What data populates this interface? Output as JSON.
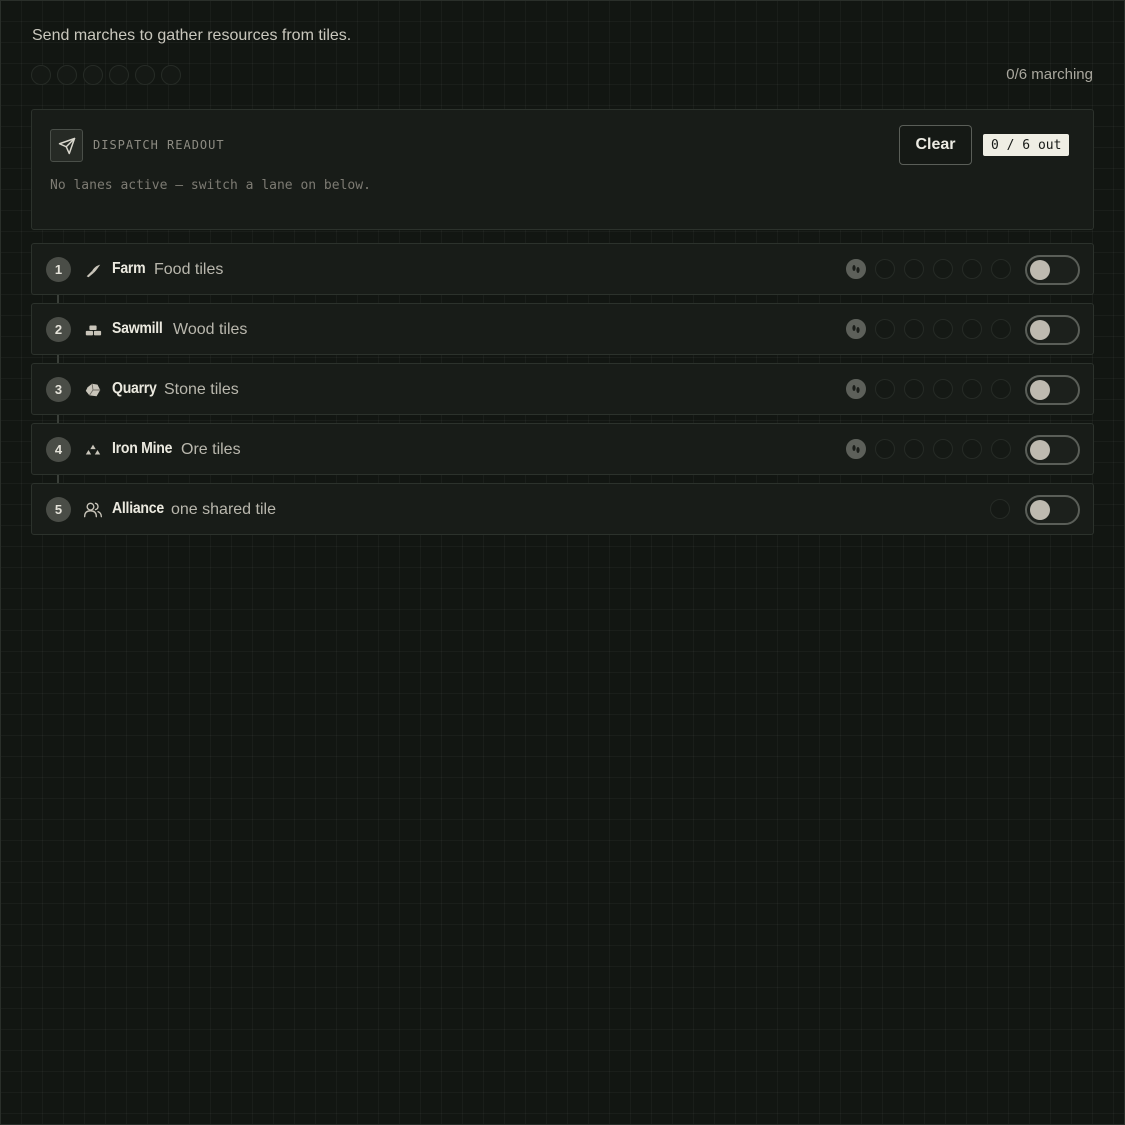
{
  "intro": "Send marches to gather resources from tiles.",
  "march_status": "0/6 marching",
  "march_dots_total": 6,
  "readout": {
    "title": "DISPATCH READOUT",
    "message": "No lanes active — switch a lane on below.",
    "clear_label": "Clear",
    "out_badge": "0 / 6 out",
    "icon": "send-icon"
  },
  "lanes": [
    {
      "num": "1",
      "name": "Farm",
      "desc": "Food tiles",
      "icon": "sickle-icon",
      "slots": 6,
      "enabled": false
    },
    {
      "num": "2",
      "name": "Sawmill",
      "desc": "Wood tiles",
      "icon": "logs-icon",
      "slots": 6,
      "enabled": false
    },
    {
      "num": "3",
      "name": "Quarry",
      "desc": "Stone tiles",
      "icon": "stone-icon",
      "slots": 6,
      "enabled": false
    },
    {
      "num": "4",
      "name": "Iron Mine",
      "desc": "Ore tiles",
      "icon": "ore-icon",
      "slots": 6,
      "enabled": false
    },
    {
      "num": "5",
      "name": "Alliance",
      "desc": "one shared tile",
      "icon": "users-icon",
      "slots": 1,
      "enabled": false
    }
  ]
}
